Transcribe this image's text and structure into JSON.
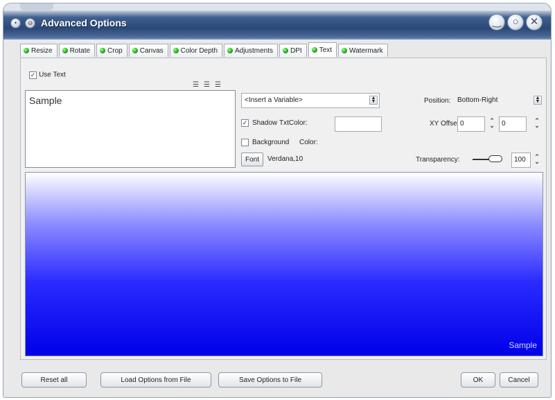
{
  "window": {
    "title": "Advanced Options",
    "controls": [
      "minimize-icon",
      "restore-icon",
      "close-icon"
    ]
  },
  "tabs": [
    {
      "label": "Resize",
      "active": false
    },
    {
      "label": "Rotate",
      "active": false
    },
    {
      "label": "Crop",
      "active": false
    },
    {
      "label": "Canvas",
      "active": false
    },
    {
      "label": "Color Depth",
      "active": false
    },
    {
      "label": "Adjustments",
      "active": false
    },
    {
      "label": "DPI",
      "active": false
    },
    {
      "label": "Text",
      "active": true
    },
    {
      "label": "Watermark",
      "active": false
    }
  ],
  "text_tab": {
    "use_text_label": "Use Text",
    "use_text_checked": true,
    "text_value": "Sample",
    "variable_select": "<Insert a Variable>",
    "shadow_label": "Shadow",
    "shadow_checked": true,
    "txtcolor_label": "TxtColor:",
    "background_label": "Background",
    "background_checked": false,
    "color_label": "Color:",
    "font_button": "Font",
    "font_value": "Verdana,10",
    "position_label": "Position:",
    "position_value": "Bottom-Right",
    "xy_offset_label": "XY Offset",
    "x_offset": "0",
    "y_offset": "0",
    "transparency_label": "Transparency:",
    "transparency_value": "100",
    "transparency_level_percent": 100,
    "preview_text": "Sample"
  },
  "footer": {
    "reset_all": "Reset all",
    "load_options": "Load Options from File",
    "save_options": "Save Options to File",
    "ok": "OK",
    "cancel": "Cancel"
  },
  "colors": {
    "title_bar": "#2b4877",
    "tab_dot": "#20a614",
    "preview_blue": "#0000e8"
  }
}
